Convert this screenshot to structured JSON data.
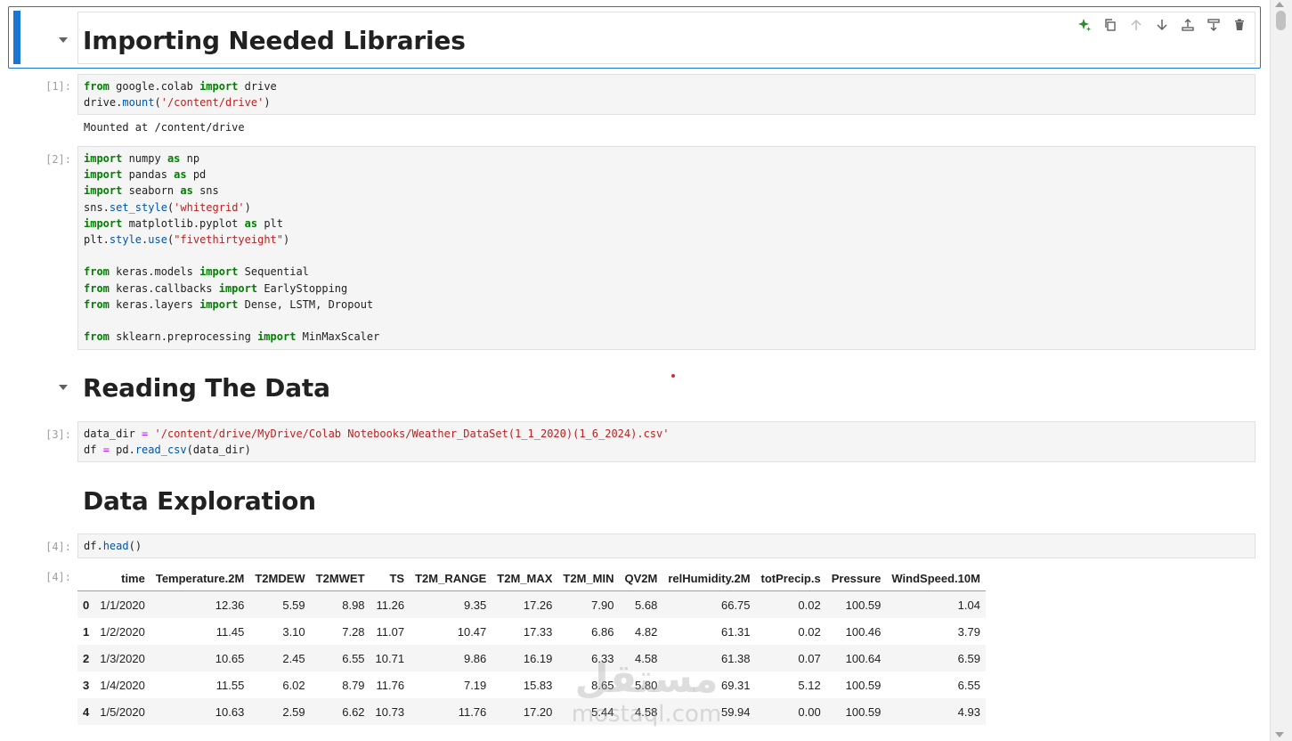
{
  "cells": [
    {
      "type": "markdown",
      "heading": "Importing Needed Libraries"
    },
    {
      "type": "code",
      "prompt": "[1]:",
      "lines": [
        [
          [
            "kw",
            "from"
          ],
          [
            "t",
            " google.colab "
          ],
          [
            "kw",
            "import"
          ],
          [
            "t",
            " drive"
          ]
        ],
        [
          [
            "t",
            "drive."
          ],
          [
            "attr",
            "mount"
          ],
          [
            "t",
            "("
          ],
          [
            "str",
            "'/content/drive'"
          ],
          [
            "t",
            ")"
          ]
        ]
      ],
      "output": "Mounted at /content/drive"
    },
    {
      "type": "code",
      "prompt": "[2]:",
      "lines": [
        [
          [
            "kw",
            "import"
          ],
          [
            "t",
            " numpy "
          ],
          [
            "kw",
            "as"
          ],
          [
            "t",
            " np"
          ]
        ],
        [
          [
            "kw",
            "import"
          ],
          [
            "t",
            " pandas "
          ],
          [
            "kw",
            "as"
          ],
          [
            "t",
            " pd"
          ]
        ],
        [
          [
            "kw",
            "import"
          ],
          [
            "t",
            " seaborn "
          ],
          [
            "kw",
            "as"
          ],
          [
            "t",
            " sns"
          ]
        ],
        [
          [
            "t",
            "sns."
          ],
          [
            "attr",
            "set_style"
          ],
          [
            "t",
            "("
          ],
          [
            "str",
            "'whitegrid'"
          ],
          [
            "t",
            ")"
          ]
        ],
        [
          [
            "kw",
            "import"
          ],
          [
            "t",
            " matplotlib.pyplot "
          ],
          [
            "kw",
            "as"
          ],
          [
            "t",
            " plt"
          ]
        ],
        [
          [
            "t",
            "plt."
          ],
          [
            "attr",
            "style"
          ],
          [
            "t",
            "."
          ],
          [
            "attr",
            "use"
          ],
          [
            "t",
            "("
          ],
          [
            "str",
            "\"fivethirtyeight\""
          ],
          [
            "t",
            ")"
          ]
        ],
        [
          [
            "t",
            ""
          ]
        ],
        [
          [
            "kw",
            "from"
          ],
          [
            "t",
            " keras.models "
          ],
          [
            "kw",
            "import"
          ],
          [
            "t",
            " Sequential"
          ]
        ],
        [
          [
            "kw",
            "from"
          ],
          [
            "t",
            " keras.callbacks "
          ],
          [
            "kw",
            "import"
          ],
          [
            "t",
            " EarlyStopping"
          ]
        ],
        [
          [
            "kw",
            "from"
          ],
          [
            "t",
            " keras.layers "
          ],
          [
            "kw",
            "import"
          ],
          [
            "t",
            " Dense, LSTM, Dropout"
          ]
        ],
        [
          [
            "t",
            ""
          ]
        ],
        [
          [
            "kw",
            "from"
          ],
          [
            "t",
            " sklearn.preprocessing "
          ],
          [
            "kw",
            "import"
          ],
          [
            "t",
            " MinMaxScaler"
          ]
        ]
      ]
    },
    {
      "type": "markdown",
      "heading": "Reading The Data"
    },
    {
      "type": "code",
      "prompt": "[3]:",
      "lines": [
        [
          [
            "t",
            "data_dir "
          ],
          [
            "op",
            "="
          ],
          [
            "t",
            " "
          ],
          [
            "str",
            "'/content/drive/MyDrive/Colab Notebooks/Weather_DataSet(1_1_2020)(1_6_2024).csv'"
          ]
        ],
        [
          [
            "t",
            "df "
          ],
          [
            "op",
            "="
          ],
          [
            "t",
            " pd."
          ],
          [
            "attr",
            "read_csv"
          ],
          [
            "t",
            "(data_dir)"
          ]
        ]
      ]
    },
    {
      "type": "markdown",
      "heading": "Data Exploration"
    },
    {
      "type": "code",
      "prompt": "[4]:",
      "lines": [
        [
          [
            "t",
            "df."
          ],
          [
            "attr",
            "head"
          ],
          [
            "t",
            "()"
          ]
        ]
      ],
      "output_prompt": "[4]:"
    }
  ],
  "table": {
    "columns": [
      "",
      "time",
      "Temperature.2M",
      "T2MDEW",
      "T2MWET",
      "TS",
      "T2M_RANGE",
      "T2M_MAX",
      "T2M_MIN",
      "QV2M",
      "relHumidity.2M",
      "totPrecip.s",
      "Pressure",
      "WindSpeed.10M"
    ],
    "rows": [
      [
        "0",
        "1/1/2020",
        "12.36",
        "5.59",
        "8.98",
        "11.26",
        "9.35",
        "17.26",
        "7.90",
        "5.68",
        "66.75",
        "0.02",
        "100.59",
        "1.04"
      ],
      [
        "1",
        "1/2/2020",
        "11.45",
        "3.10",
        "7.28",
        "11.07",
        "10.47",
        "17.33",
        "6.86",
        "4.82",
        "61.31",
        "0.02",
        "100.46",
        "3.79"
      ],
      [
        "2",
        "1/3/2020",
        "10.65",
        "2.45",
        "6.55",
        "10.71",
        "9.86",
        "16.19",
        "6.33",
        "4.58",
        "61.38",
        "0.07",
        "100.64",
        "6.59"
      ],
      [
        "3",
        "1/4/2020",
        "11.55",
        "6.02",
        "8.79",
        "11.76",
        "7.19",
        "15.83",
        "8.65",
        "5.80",
        "69.31",
        "5.12",
        "100.59",
        "6.55"
      ],
      [
        "4",
        "1/5/2020",
        "10.63",
        "2.59",
        "6.62",
        "10.73",
        "11.76",
        "17.20",
        "5.44",
        "4.58",
        "59.94",
        "0.00",
        "100.59",
        "4.93"
      ]
    ]
  },
  "toolbar": {
    "icons": [
      "sparkle-icon",
      "duplicate-icon",
      "move-up-icon",
      "move-down-icon",
      "insert-above-icon",
      "insert-below-icon",
      "delete-icon"
    ]
  },
  "watermark": {
    "arabic": "مستقل",
    "latin": "mostaql.com"
  },
  "colors": {
    "accent": "#1976d2",
    "keyword": "#008000",
    "string": "#ba2121",
    "attribute": "#0055aa",
    "operator": "#aa22ff"
  }
}
